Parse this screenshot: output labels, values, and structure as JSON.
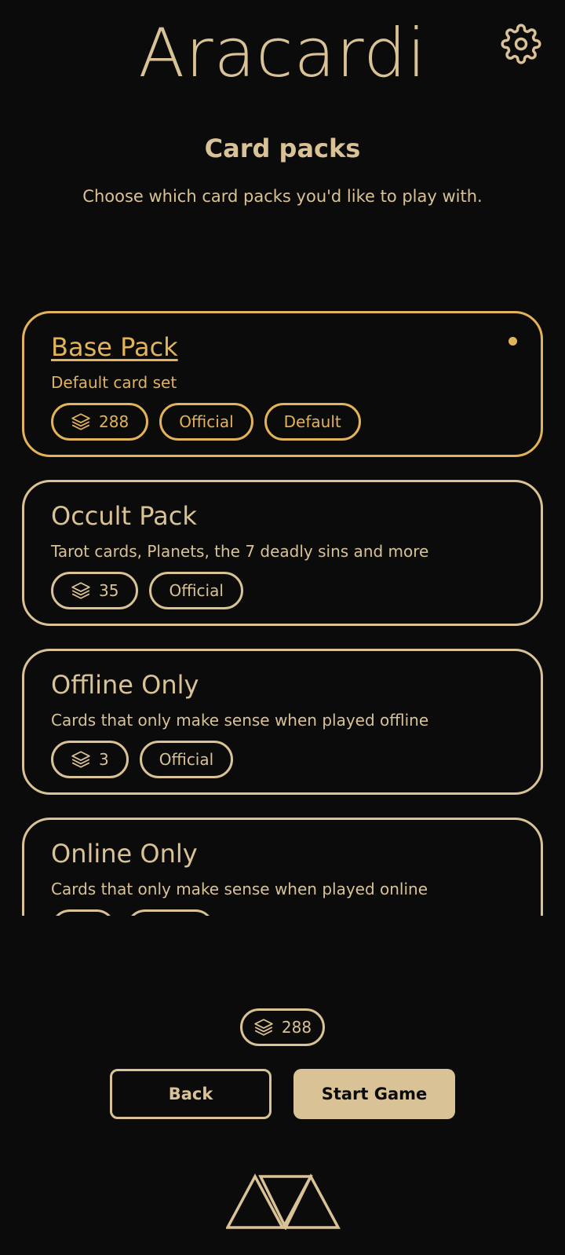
{
  "header": {
    "title": "Aracardi",
    "settings_icon": "gear-icon"
  },
  "section": {
    "title": "Card packs",
    "subtitle": "Choose which card packs you'd like to play with."
  },
  "packs": [
    {
      "name": "Base Pack",
      "description": "Default card set",
      "count": "288",
      "tags": [
        "Official",
        "Default"
      ],
      "selected": true
    },
    {
      "name": "Occult Pack",
      "description": "Tarot cards, Planets, the 7 deadly sins and more",
      "count": "35",
      "tags": [
        "Official"
      ],
      "selected": false
    },
    {
      "name": "Offline Only",
      "description": "Cards that only make sense when played offline",
      "count": "3",
      "tags": [
        "Official"
      ],
      "selected": false
    },
    {
      "name": "Online Only",
      "description": "Cards that only make sense when played online",
      "count": "",
      "tags": [
        ""
      ],
      "selected": false
    }
  ],
  "footer": {
    "total_count": "288",
    "back_label": "Back",
    "start_label": "Start Game"
  },
  "colors": {
    "background": "#0b0b0b",
    "primary": "#d9c295",
    "selected": "#e2b35a"
  }
}
